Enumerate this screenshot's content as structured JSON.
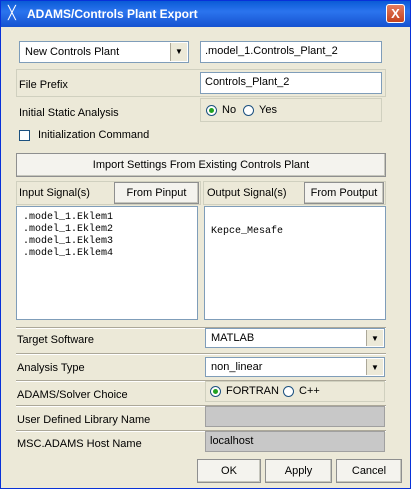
{
  "window": {
    "title": "ADAMS/Controls Plant Export",
    "close_glyph": "X"
  },
  "plant_mode": {
    "selected": "New Controls Plant",
    "name_value": ".model_1.Controls_Plant_2"
  },
  "file_prefix": {
    "label": "File Prefix",
    "value": "Controls_Plant_2"
  },
  "initial_static": {
    "label": "Initial Static Analysis",
    "opt_no": "No",
    "opt_yes": "Yes",
    "selected": "No"
  },
  "init_command": {
    "label": "Initialization Command",
    "checked": false
  },
  "import_button": "Import Settings From Existing Controls Plant",
  "input_signals": {
    "label": "Input Signal(s)",
    "button": "From Pinput",
    "items": [
      ".model_1.Eklem1",
      ".model_1.Eklem2",
      ".model_1.Eklem3",
      ".model_1.Eklem4"
    ]
  },
  "output_signals": {
    "label": "Output Signal(s)",
    "button": "From Poutput",
    "items": [
      "Kepce_Mesafe"
    ]
  },
  "target_software": {
    "label": "Target Software",
    "value": "MATLAB"
  },
  "analysis_type": {
    "label": "Analysis Type",
    "value": "non_linear"
  },
  "solver_choice": {
    "label": "ADAMS/Solver Choice",
    "opt_fortran": "FORTRAN",
    "opt_cpp": "C++",
    "selected": "FORTRAN"
  },
  "user_library": {
    "label": "User Defined Library Name",
    "value": ""
  },
  "host_name": {
    "label": "MSC.ADAMS Host Name",
    "value": "localhost"
  },
  "footer": {
    "ok": "OK",
    "apply": "Apply",
    "cancel": "Cancel"
  }
}
